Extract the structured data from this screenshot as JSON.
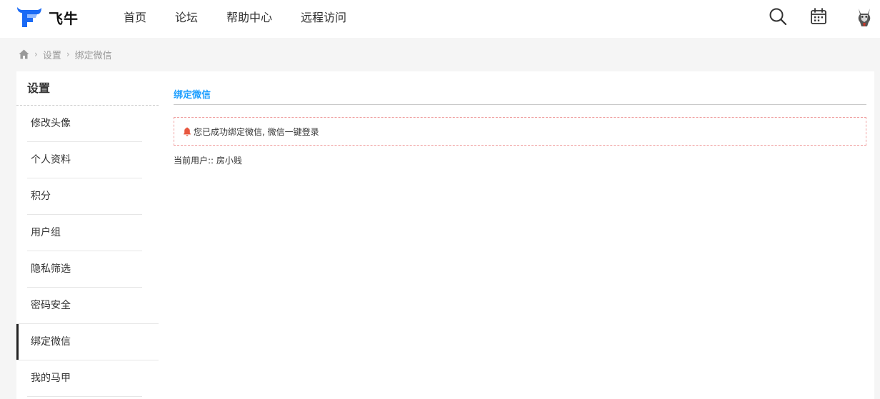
{
  "header": {
    "logo_text": "飞牛",
    "nav": [
      {
        "label": "首页"
      },
      {
        "label": "论坛"
      },
      {
        "label": "帮助中心"
      },
      {
        "label": "远程访问"
      }
    ],
    "icons": {
      "search": "search-icon",
      "calendar": "calendar-icon",
      "avatar": "user-avatar"
    }
  },
  "breadcrumb": {
    "home_icon": "home-icon",
    "items": [
      "设置",
      "绑定微信"
    ]
  },
  "sidebar": {
    "title": "设置",
    "items": [
      {
        "label": "修改头像"
      },
      {
        "label": "个人资料"
      },
      {
        "label": "积分"
      },
      {
        "label": "用户组"
      },
      {
        "label": "隐私筛选"
      },
      {
        "label": "密码安全"
      },
      {
        "label": "绑定微信"
      },
      {
        "label": "我的马甲"
      }
    ],
    "active_index": 6
  },
  "main": {
    "title": "绑定微信",
    "alert_text": "您已成功绑定微信, 微信一键登录",
    "current_user_label": "当前用户:: 房小贱"
  },
  "colors": {
    "accent": "#1e9fff",
    "alert_border": "#f0a0a0",
    "bell": "#e8573f",
    "logo_blue": "#1a6af5"
  }
}
